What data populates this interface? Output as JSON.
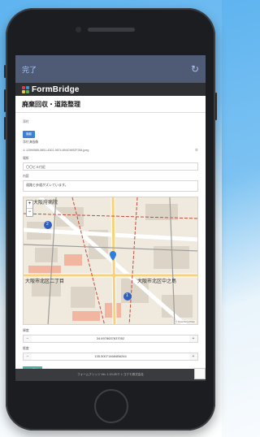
{
  "nav": {
    "done_label": "完了",
    "refresh_icon": "refresh-icon"
  },
  "brand": {
    "name": "FormBridge",
    "logo_colors": [
      "#e63b3b",
      "#2e9bd6",
      "#f3c53a",
      "#4fb34f"
    ]
  },
  "form": {
    "title": "廃棄回収・道路整理",
    "photo_label": "添付",
    "photo_button": "撮影",
    "file_caption": "添付済画像",
    "file_name": "12590585-5851-4301-9874-894C9692F284.jpeg",
    "place_label": "場所",
    "place_value": "〇〇ビル付近",
    "content_label": "内容",
    "content_value": "道路と歩道がズレています。",
    "lat_label": "緯度",
    "lat_value": "34.6978637637052",
    "lng_label": "経度",
    "lng_value": "135.500714684B6264",
    "save_label": "保存"
  },
  "map": {
    "labels": {
      "top": "大阪府病院",
      "left": "大阪市北区二丁目",
      "right": "大阪市北区中之島",
      "route1": "2",
      "route2": "1"
    },
    "attribution": "© OpenStreetMap"
  },
  "footer": {
    "text": "フォームブリッジ Ver. 1.10.28 © トヨクモ株式会社"
  }
}
